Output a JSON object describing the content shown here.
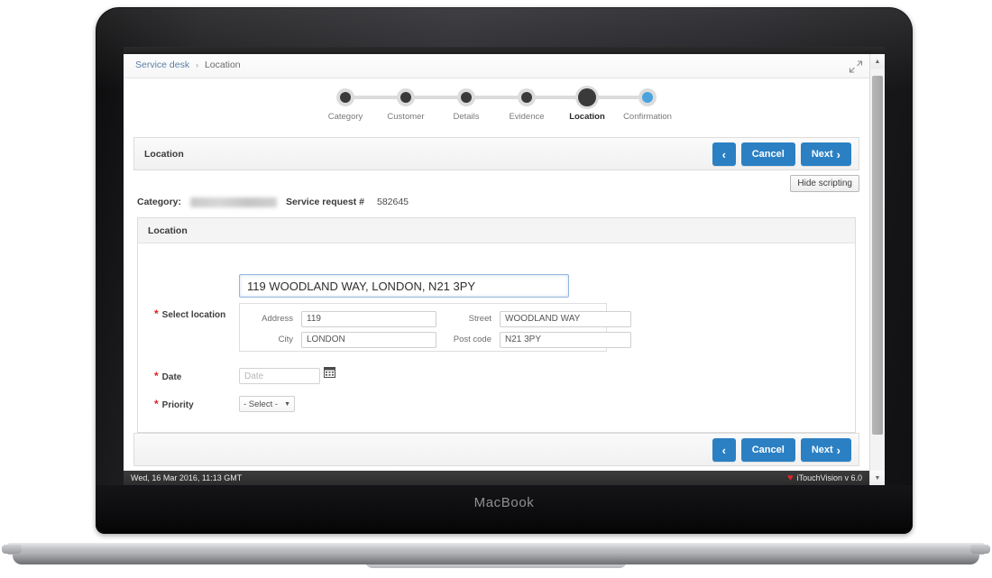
{
  "device": {
    "brand_label": "MacBook"
  },
  "browser": {
    "breadcrumb": {
      "root": "Service desk",
      "separator": "›",
      "current": "Location"
    },
    "expand_icon": "expand-collapse-arrows-icon",
    "scrollbar": {
      "up_glyph": "▲",
      "down_glyph": "▼"
    }
  },
  "stepper": {
    "steps": [
      {
        "label": "Category",
        "state": "complete"
      },
      {
        "label": "Customer",
        "state": "complete"
      },
      {
        "label": "Details",
        "state": "complete"
      },
      {
        "label": "Evidence",
        "state": "complete"
      },
      {
        "label": "Location",
        "state": "active"
      },
      {
        "label": "Confirmation",
        "state": "pending"
      }
    ]
  },
  "section": {
    "title": "Location",
    "back_glyph": "‹",
    "cancel_label": "Cancel",
    "next_label": "Next",
    "next_glyph": "›"
  },
  "toolbar": {
    "hide_scripting_label": "Hide scripting"
  },
  "meta": {
    "category_label": "Category:",
    "category_value": "",
    "service_request_label": "Service request #",
    "service_request_value": "582645"
  },
  "card": {
    "title": "Location",
    "fields": {
      "select_location": {
        "label": "Select location",
        "required": true,
        "search_value": "119 WOODLAND WAY, LONDON, N21 3PY",
        "sub": {
          "address_label": "Address",
          "address_value": "119",
          "street_label": "Street",
          "street_value": "WOODLAND WAY",
          "city_label": "City",
          "city_value": "LONDON",
          "postcode_label": "Post code",
          "postcode_value": "N21 3PY"
        }
      },
      "date": {
        "label": "Date",
        "required": true,
        "value": "",
        "placeholder": "Date",
        "icon": "calendar-icon"
      },
      "priority": {
        "label": "Priority",
        "required": true,
        "selected": "- Select -",
        "caret_glyph": "▼",
        "options": [
          "- Select -"
        ]
      }
    }
  },
  "status": {
    "datetime": "Wed, 16 Mar 2016, 11:13 GMT",
    "product": "iTouchVision v 6.0",
    "heart_glyph": "♥"
  },
  "colors": {
    "accent_blue": "#2b80c3",
    "required_red": "#e02020",
    "status_bar": "#333333",
    "heart_red": "#e0242c",
    "step_active": "#3a3a3a",
    "step_pending": "#4aa3de",
    "step_track": "#dcdcdc"
  }
}
